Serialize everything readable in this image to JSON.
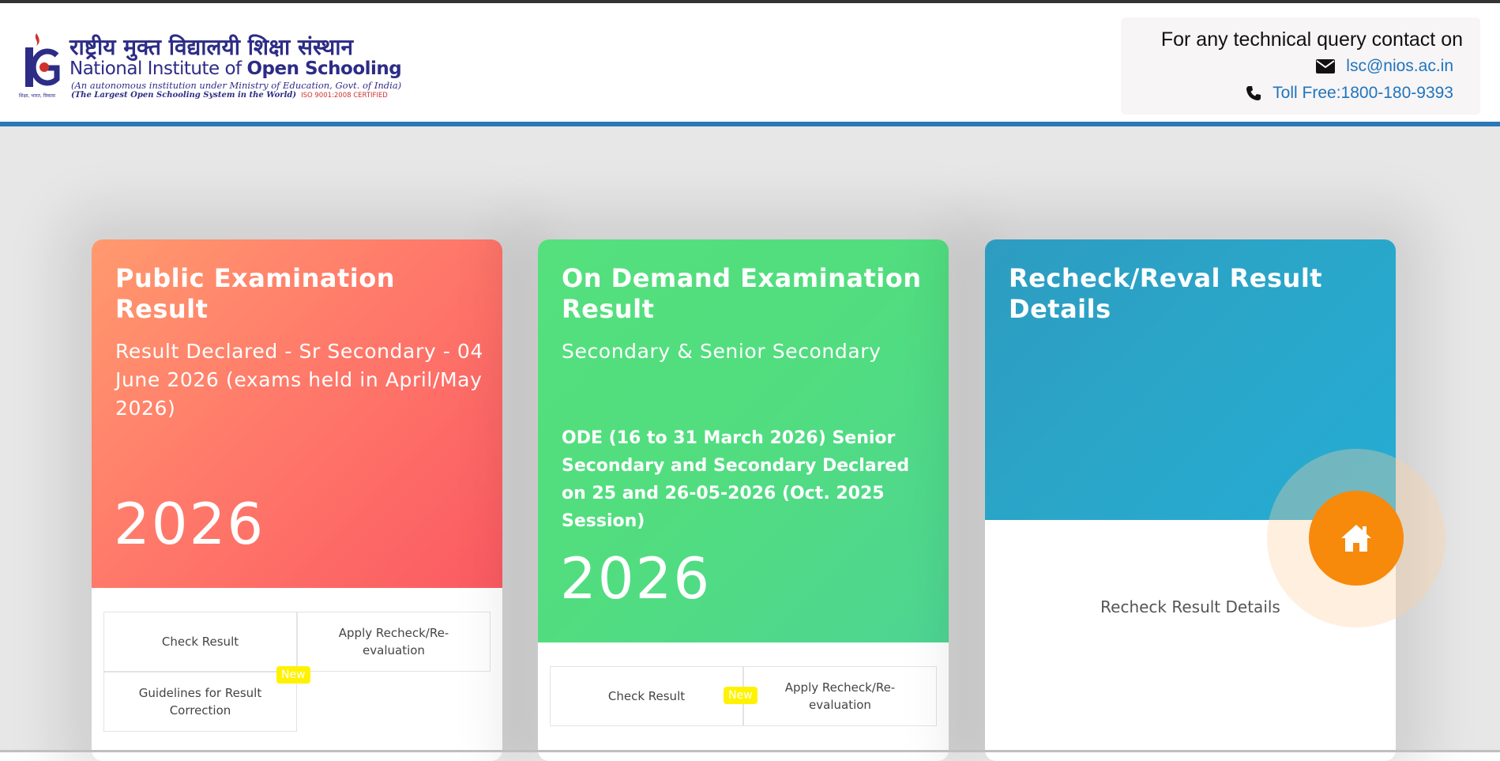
{
  "header": {
    "logo": {
      "hindi_name": "राष्ट्रीय मुक्त विद्यालयी शिक्षा संस्थान",
      "english_name_part1": "National Institute of ",
      "english_name_part2": "Open Schooling",
      "subtitle": "(An autonomous institution under Ministry of Education, Govt. of India)",
      "tagline": "(The Largest Open Schooling System in the World)",
      "iso": "ISO 9001:2008 CERTIFIED",
      "emblem_caption": "शिक्षा, भारत, विकास"
    },
    "contact": {
      "title": "For any technical query contact on",
      "email": "lsc@nios.ac.in",
      "phone": "Toll Free:1800-180-9393",
      "email_icon": "envelope-icon",
      "phone_icon": "phone-icon"
    }
  },
  "cards": [
    {
      "title": "Public Examination Result",
      "subtitle": "Result Declared - Sr Secondary - 04 June 2026 (exams held in April/May 2026)",
      "year": "2026",
      "links": [
        "Check Result",
        "Apply Recheck/Re-evaluation",
        "Guidelines for Result Correction"
      ],
      "badge": "New"
    },
    {
      "title": "On Demand Examination Result",
      "subtitle": "Secondary & Senior Secondary",
      "note": "ODE (16 to 31 March 2026) Senior Secondary and Secondary Declared on 25 and 26-05-2026 (Oct. 2025 Session)",
      "year": "2026",
      "links": [
        "Check Result",
        "Apply Recheck/Re-evaluation"
      ],
      "badge": "New"
    },
    {
      "title": "Recheck/Reval Result Details",
      "link": "Recheck Result Details"
    }
  ],
  "home_button": {
    "icon": "home-icon"
  },
  "colors": {
    "header_rule": "#2a78b6",
    "card1": "#fb6d66",
    "card2": "#51dd7f",
    "card3": "#2aa6c9",
    "home_button": "#f7890b",
    "link_blue": "#1f74bd",
    "badge": "#fff200"
  }
}
